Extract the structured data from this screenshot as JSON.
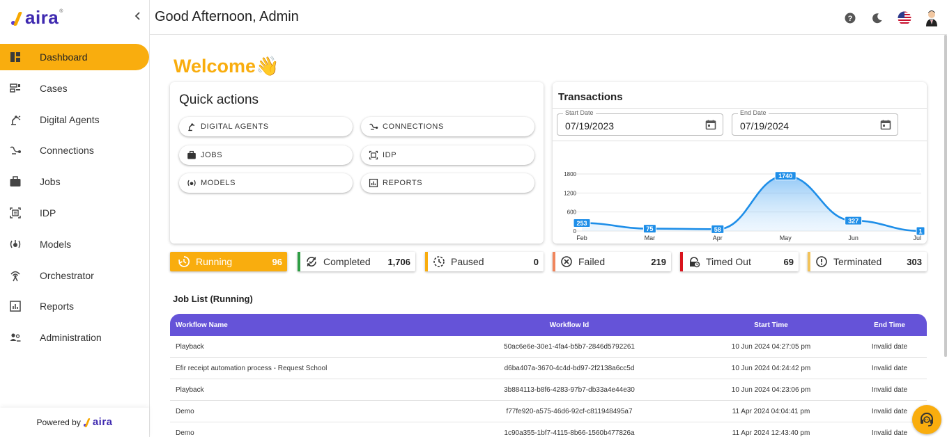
{
  "brand": {
    "name": "aira"
  },
  "header": {
    "greeting": "Good Afternoon, Admin"
  },
  "sidebar": {
    "items": [
      {
        "label": "Dashboard",
        "icon": "dashboard-icon",
        "active": true
      },
      {
        "label": "Cases",
        "icon": "cases-icon"
      },
      {
        "label": "Digital Agents",
        "icon": "robot-arm-icon"
      },
      {
        "label": "Connections",
        "icon": "connections-icon"
      },
      {
        "label": "Jobs",
        "icon": "briefcase-icon"
      },
      {
        "label": "IDP",
        "icon": "document-scan-icon"
      },
      {
        "label": "Models",
        "icon": "model-icon"
      },
      {
        "label": "Orchestrator",
        "icon": "antenna-icon"
      },
      {
        "label": "Reports",
        "icon": "reports-icon"
      },
      {
        "label": "Administration",
        "icon": "users-icon"
      }
    ],
    "footer": {
      "powered_by": "Powered by",
      "brand": "aira"
    }
  },
  "main": {
    "welcome": "Welcome👋",
    "quick_actions": {
      "title": "Quick actions",
      "buttons": [
        {
          "label": "DIGITAL AGENTS",
          "icon": "robot-arm-icon"
        },
        {
          "label": "CONNECTIONS",
          "icon": "connections-icon"
        },
        {
          "label": "JOBS",
          "icon": "briefcase-icon"
        },
        {
          "label": "IDP",
          "icon": "document-scan-icon"
        },
        {
          "label": "MODELS",
          "icon": "model-icon"
        },
        {
          "label": "REPORTS",
          "icon": "reports-icon"
        }
      ]
    },
    "transactions": {
      "title": "Transactions",
      "start_date": {
        "label": "Start Date",
        "value": "07/19/2023"
      },
      "end_date": {
        "label": "End Date",
        "value": "07/19/2024"
      }
    },
    "statuses": [
      {
        "label": "Running",
        "count": "96",
        "color": "#f9ad0e",
        "icon": "running-icon"
      },
      {
        "label": "Completed",
        "count": "1,706",
        "color": "#2e9e44",
        "icon": "completed-icon"
      },
      {
        "label": "Paused",
        "count": "0",
        "color": "#f9ad0e",
        "icon": "paused-icon"
      },
      {
        "label": "Failed",
        "count": "219",
        "color": "#f0855c",
        "icon": "failed-icon"
      },
      {
        "label": "Timed Out",
        "count": "69",
        "color": "#d9141d",
        "icon": "timed-out-icon"
      },
      {
        "label": "Terminated",
        "count": "303",
        "color": "#f2c35a",
        "icon": "terminated-icon"
      }
    ],
    "job_list": {
      "title": "Job List (Running)",
      "columns": [
        "Workflow Name",
        "Workflow Id",
        "Start Time",
        "End Time"
      ],
      "rows": [
        [
          "Playback",
          "50ac6e6e-30e1-4fa4-b5b7-2846d5792261",
          "10 Jun 2024 04:27:05 pm",
          "Invalid date"
        ],
        [
          "Efir receipt automation process - Request School",
          "d6ba407a-3670-4c4d-bd97-2f2138a6cc5d",
          "10 Jun 2024 04:24:42 pm",
          "Invalid date"
        ],
        [
          "Playback",
          "3b884113-b8f6-4283-97b7-db33a4e44e30",
          "10 Jun 2024 04:23:06 pm",
          "Invalid date"
        ],
        [
          "Demo",
          "f77fe920-a575-46d6-92cf-c811948495a7",
          "11 Apr 2024 04:04:41 pm",
          "Invalid date"
        ],
        [
          "Demo",
          "1c90a355-1bf7-4115-8b66-1560b477826a",
          "11 Apr 2024 12:43:40 pm",
          "Invalid date"
        ]
      ]
    }
  },
  "chart_data": {
    "type": "area",
    "categories": [
      "Feb",
      "Mar",
      "Apr",
      "May",
      "Jun",
      "Jul"
    ],
    "values": [
      253,
      75,
      58,
      1740,
      327,
      1
    ],
    "yticks": [
      "1800",
      "1200",
      "600",
      "0"
    ],
    "ylim": [
      0,
      1800
    ],
    "grid": true,
    "line_color": "#1e8ee8"
  }
}
